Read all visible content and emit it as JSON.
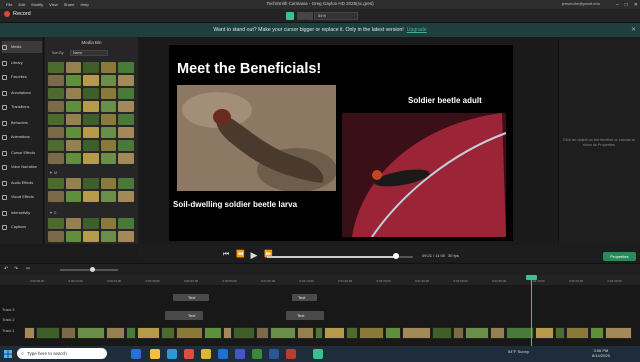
{
  "menu": [
    "File",
    "Edit",
    "Modify",
    "View",
    "Share",
    "Help"
  ],
  "window_title": "TechSmith Camtasia - Greg Gaylon HD 2025(sc.gres)",
  "user": "jensmobe@peart.edu",
  "window_controls": [
    "–",
    "□",
    "✕"
  ],
  "toolbar": {
    "record_label": "Record",
    "zoom_value": "54%"
  },
  "banner": {
    "text": "Want to stand out? Make your cursor bigger or replace it. Only in the latest version!",
    "link": "Upgrade",
    "close": "✕"
  },
  "nav": [
    {
      "label": "Media",
      "icon": "media-icon"
    },
    {
      "label": "Library",
      "icon": "library-icon"
    },
    {
      "label": "Favorites",
      "icon": "star-icon"
    },
    {
      "label": "Annotations",
      "icon": "annotation-icon"
    },
    {
      "label": "Transitions",
      "icon": "transition-icon"
    },
    {
      "label": "Behaviors",
      "icon": "behavior-icon"
    },
    {
      "label": "Animations",
      "icon": "animation-icon"
    },
    {
      "label": "Cursor Effects",
      "icon": "cursor-icon"
    },
    {
      "label": "Voice Narration",
      "icon": "mic-icon"
    },
    {
      "label": "Audio Effects",
      "icon": "audio-icon"
    },
    {
      "label": "Visual Effects",
      "icon": "visual-effects-icon"
    },
    {
      "label": "Interactivity",
      "icon": "interactivity-icon"
    },
    {
      "label": "Captions",
      "icon": "captions-icon"
    }
  ],
  "bin": {
    "title": "Media Bin",
    "sort_label": "Sort By",
    "sort_value": "Name",
    "section_a": "▼ M",
    "section_b": "▼ S"
  },
  "slide": {
    "title": "Meet the Beneficials!",
    "caption_larva": "Soil-dwelling soldier  beetle larva",
    "caption_adult": "Soldier  beetle adult"
  },
  "properties": {
    "hint": "Click an object on the timeline or canvas to show its Properties",
    "button": "Properties"
  },
  "playback": {
    "timecode": "09:21 / 11:00",
    "fps": "30 fps"
  },
  "timeline": {
    "ticks": [
      "0:00:00;00",
      "0:00:10;00",
      "0:00:20;00",
      "0:00:30;00",
      "0:00:40;00",
      "0:00:50;00",
      "0:01:00;00",
      "0:01:10;00",
      "0:01:20;00",
      "0:01:30;00",
      "0:01:40;00",
      "0:01:50;00",
      "0:02:00;00",
      "0:02:10;00",
      "0:02:20;00",
      "0:02:30;00"
    ],
    "marker_label": "Marker",
    "tracks": [
      "Track 3",
      "Track 2",
      "Track 1"
    ],
    "text_clip": "Text"
  },
  "taskbar": {
    "search_placeholder": "Type here to search",
    "weather": "54°F  Sunny",
    "time": "3:56 PM",
    "date": "8/14/2025"
  }
}
